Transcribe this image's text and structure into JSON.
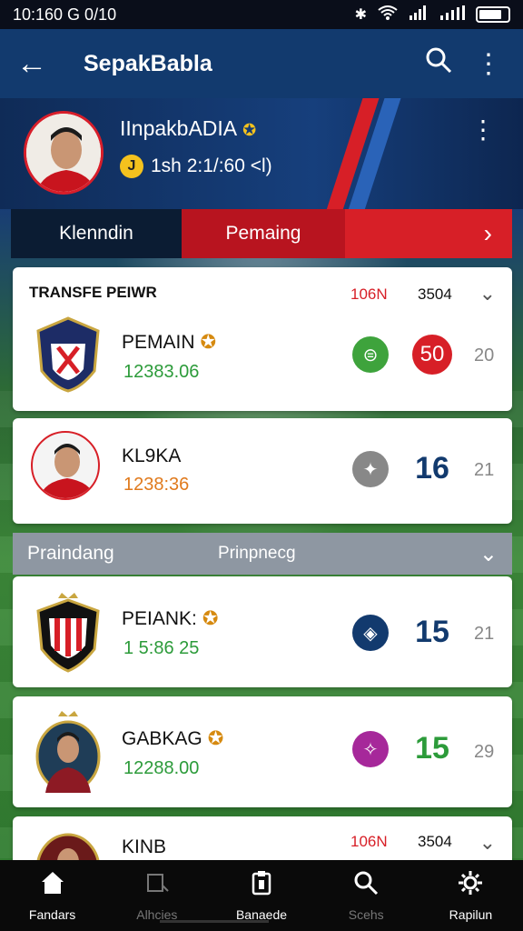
{
  "status_bar": {
    "time": "10:160 G 0/10"
  },
  "app_bar": {
    "title": "SepakBabla"
  },
  "profile": {
    "name": "IInpakbADIA",
    "sub": "1sh 2:1/:60 <l)",
    "coin_symbol": "J"
  },
  "tabs": [
    {
      "label": "Klenndin"
    },
    {
      "label": "Pemaing"
    },
    {
      "label": "›"
    }
  ],
  "cards": [
    {
      "header": "TRANSFE PEIWR",
      "tag1": "106N",
      "tag2": "3504",
      "name": "PEMAIN",
      "value": "12383.06",
      "score": "50",
      "rank": "20",
      "value_color": "#2c9b3a"
    },
    {
      "name": "KL9KA",
      "value": "1238:36",
      "score": "16",
      "rank": "21",
      "value_color": "#e07a1d"
    }
  ],
  "section": {
    "left": "Praindang",
    "right": "Prinpnecg"
  },
  "cards2": [
    {
      "name": "PEIANK:",
      "value": "1 5:86 25",
      "score": "15",
      "rank": "21",
      "value_color": "#2c9b3a"
    },
    {
      "name": "GABKAG",
      "value": "12288.00",
      "score": "15",
      "rank": "29",
      "value_color": "#2c9b3a"
    },
    {
      "name": "KINB",
      "tag1": "106N",
      "tag2": "3504"
    }
  ],
  "nav": [
    {
      "label": "Fandars",
      "icon": "home-icon"
    },
    {
      "label": "Alhcies",
      "icon": "chart-icon"
    },
    {
      "label": "Banaede",
      "icon": "clipboard-icon"
    },
    {
      "label": "Scehs",
      "icon": "search-icon"
    },
    {
      "label": "Rapilun",
      "icon": "gear-icon"
    }
  ],
  "colors": {
    "primary": "#123a6e",
    "accent": "#d71f27",
    "green": "#2c9b3a"
  }
}
